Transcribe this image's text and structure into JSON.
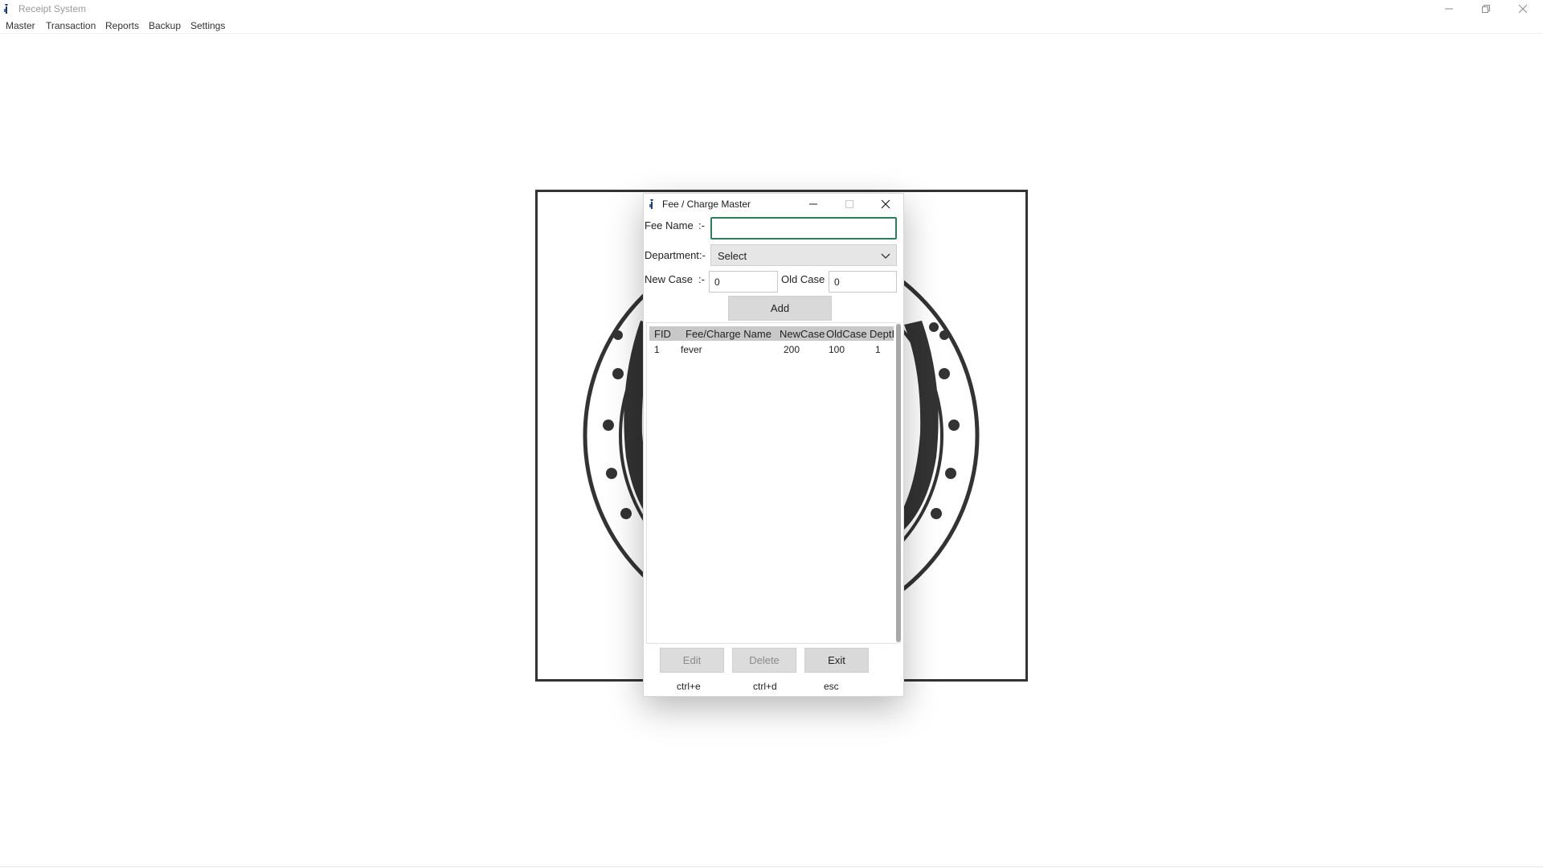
{
  "app": {
    "title": "Receipt System"
  },
  "menu": {
    "items": [
      "Master",
      "Transaction",
      "Reports",
      "Backup",
      "Settings"
    ]
  },
  "dialog": {
    "title": "Fee / Charge Master",
    "fee_name_label": "Fee Name",
    "department_label": "Department",
    "new_case_label": "New Case",
    "old_case_label": "Old Case",
    "separator": ":-",
    "fee_name_value": "",
    "department_value": "Select",
    "new_case_value": "0",
    "old_case_value": "0",
    "add_label": "Add",
    "table": {
      "columns": [
        "FID",
        "Fee/Charge Name",
        "NewCase",
        "OldCase",
        "DeptId"
      ],
      "rows": [
        [
          "1",
          "fever",
          "200",
          "100",
          "1"
        ]
      ]
    },
    "edit_label": "Edit",
    "delete_label": "Delete",
    "exit_label": "Exit",
    "edit_shortcut": "ctrl+e",
    "delete_shortcut": "ctrl+d",
    "exit_shortcut": "esc"
  },
  "icons": {
    "app": "app-logo-icon",
    "minimize": "minimize-icon",
    "maximize": "maximize-icon",
    "close": "close-icon",
    "dropdown": "chevron-down-icon"
  },
  "colors": {
    "focus_border": "#2e7d5b",
    "button_bg": "#d9d9d9",
    "table_header_bg": "#c8c8c8"
  }
}
